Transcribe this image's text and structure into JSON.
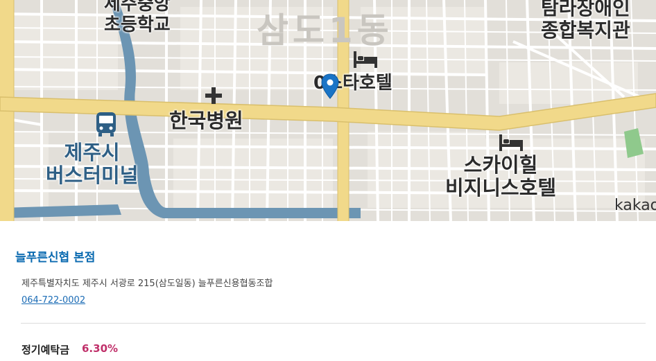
{
  "map": {
    "district": "삼도1동",
    "labels": {
      "school": "제주중앙\n초등학교",
      "welfare": "탐라장애인\n종합복지관",
      "hospital": "한국병원",
      "terminal": "제주시\n버스터미널",
      "hotel_star": "0스타호텔",
      "hotel_sky": "스카이힐\n비지니스호텔"
    },
    "attribution": "kakao",
    "icons": [
      "bus-icon",
      "hospital-cross-icon",
      "hotel-bed-icon",
      "hotel-bed-icon",
      "location-pin-icon"
    ]
  },
  "info": {
    "branch_name": "늘푸른신협 본점",
    "address": "제주특별자치도 제주시 서광로 215(삼도일동) 늘푸른신용협동조합",
    "phone": "064-722-0002",
    "rate_label": "정기예탁금",
    "rate_value": "6.30%"
  },
  "colors": {
    "main_road": "#f1d98a",
    "water": "#6c95b3",
    "pin": "#1a74c6",
    "link": "#1a6bb5",
    "rate": "#c0306a",
    "title": "#0a6ab0"
  }
}
